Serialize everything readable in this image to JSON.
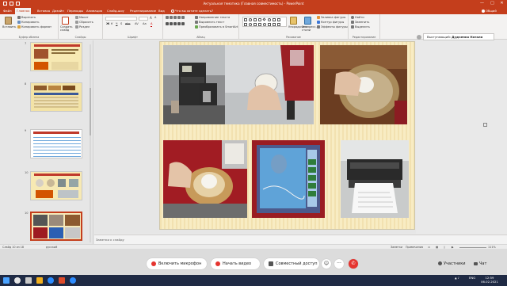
{
  "window": {
    "title": "Актуальная тематика (Главная совместимость) - PowerPoint",
    "controls": [
      "—",
      "□",
      "✕"
    ]
  },
  "tabs": [
    {
      "label": "Файл"
    },
    {
      "label": "Главная"
    },
    {
      "label": "Вставка"
    },
    {
      "label": "Дизайн"
    },
    {
      "label": "Переходы"
    },
    {
      "label": "Анимация"
    },
    {
      "label": "Слайд-шоу"
    },
    {
      "label": "Рецензирование"
    },
    {
      "label": "Вид"
    },
    {
      "label": "Что вы хотите сделать?"
    }
  ],
  "tabs_right": {
    "share": "Общий доступ"
  },
  "ribbon": {
    "clipboard": {
      "paste": "Вставить",
      "cut": "Вырезать",
      "copy": "Копировать",
      "format_painter": "Копировать формат",
      "label": "Буфер обмена"
    },
    "slides": {
      "new_slide": "Создать слайд",
      "layout": "Макет",
      "reset": "Сбросить",
      "section": "Раздел",
      "label": "Слайды"
    },
    "font": {
      "label": "Шрифт"
    },
    "paragraph": {
      "text_direction": "Направление текста",
      "align_text": "Выровнять текст",
      "smartart": "Преобразовать в SmartArt",
      "label": "Абзац"
    },
    "drawing": {
      "arrange": "Упорядочить",
      "quick_styles": "Экспресс-стили",
      "fill": "Заливка фигуры",
      "outline": "Контур фигуры",
      "effects": "Эффекты фигуры",
      "label": "Рисование"
    },
    "editing": {
      "find": "Найти",
      "replace": "Заменить",
      "select": "Выделить",
      "label": "Редактирование"
    }
  },
  "thumbnails": [
    {
      "num": "7"
    },
    {
      "num": "8"
    },
    {
      "num": "9"
    },
    {
      "num": "10"
    },
    {
      "num": "11"
    }
  ],
  "presenter": {
    "prefix": "Выступающий:",
    "name": "Дудченко Наталя"
  },
  "notes": {
    "placeholder": "Заметки к слайду"
  },
  "status": {
    "slide": "Слайд 10 из 18",
    "lang": "русский",
    "notes": "Заметки",
    "comments": "Примечания",
    "zoom": "111%"
  },
  "conference": {
    "mic": "Включить микрофон",
    "video": "Начать видео",
    "share": "Совместный доступ",
    "participants": "Участники",
    "chat": "Чат"
  },
  "taskbar": {
    "time": "12:59",
    "date": "06.02.2021",
    "lang": "ENG"
  },
  "colors": {
    "accent": "#c43e1c",
    "slide_bg": "#f8ecc3",
    "device_red": "#9e1b21",
    "end_call": "#e5342f"
  }
}
